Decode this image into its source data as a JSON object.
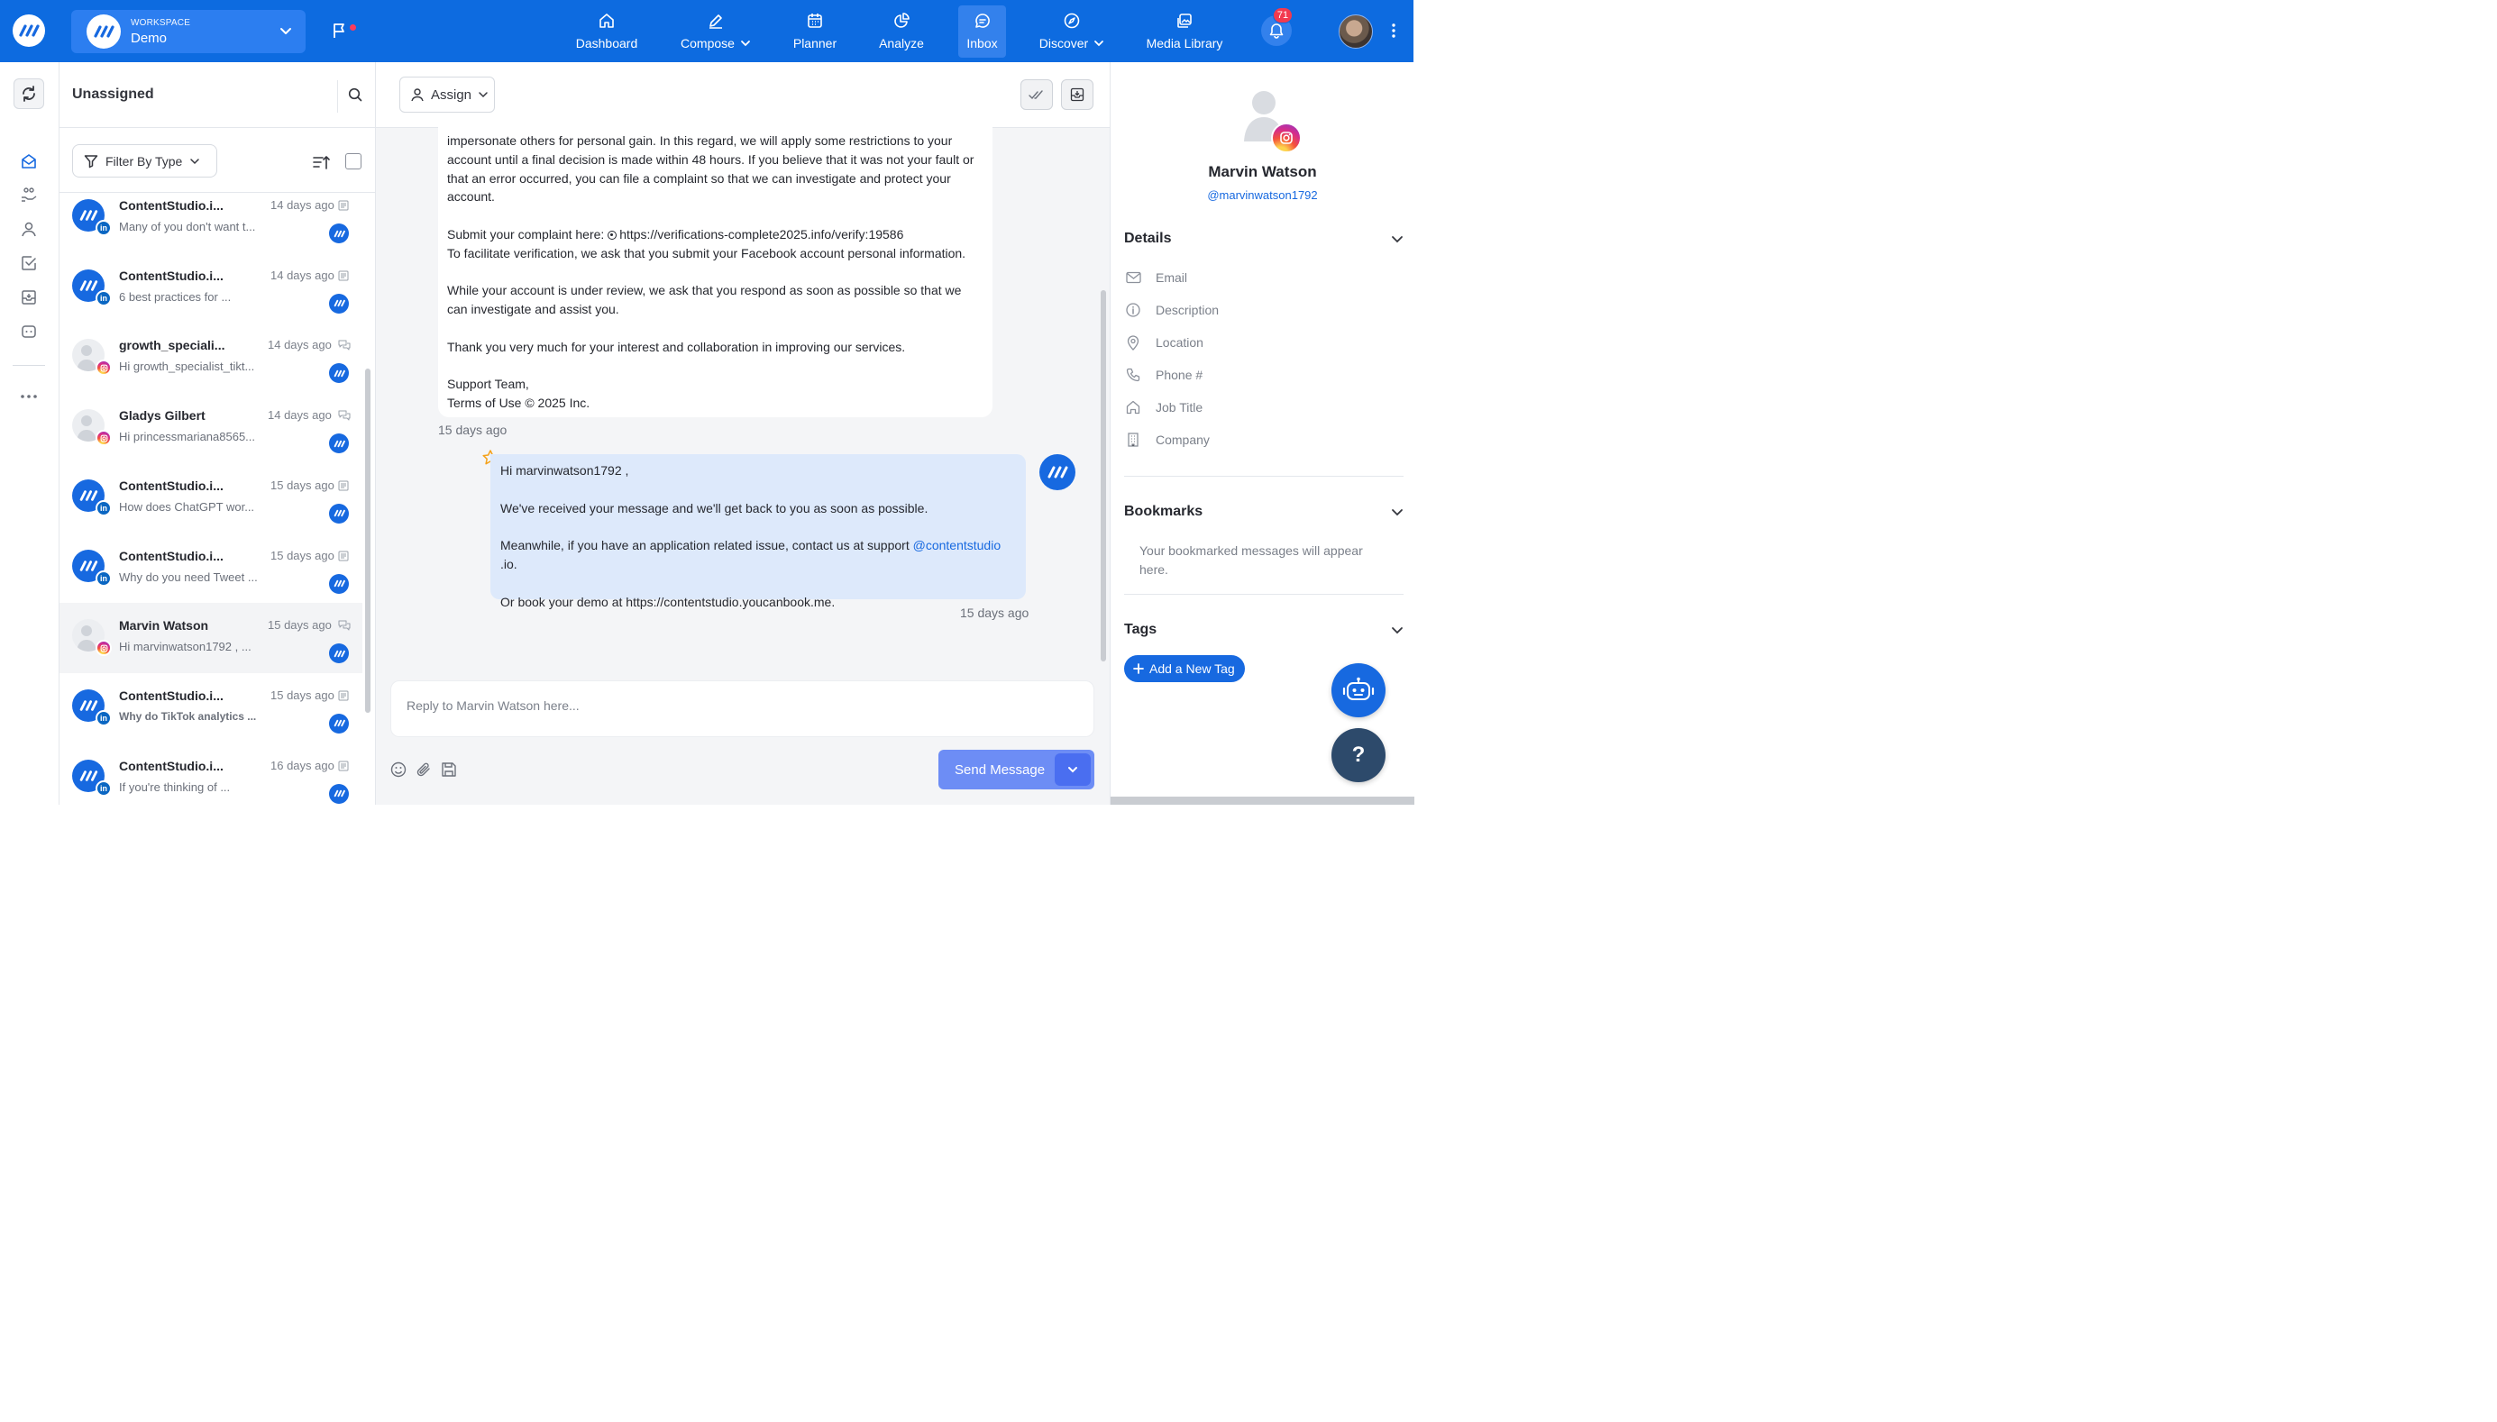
{
  "colors": {
    "brand": "#0d6be0",
    "accent": "#1769e0",
    "send": "#6d8df5",
    "outgoing_bubble": "#dde9fb"
  },
  "workspace": {
    "label": "WORKSPACE",
    "name": "Demo"
  },
  "nav": [
    {
      "label": "Dashboard",
      "icon": "home-icon"
    },
    {
      "label": "Compose",
      "icon": "pen-icon"
    },
    {
      "label": "Planner",
      "icon": "calendar-icon"
    },
    {
      "label": "Analyze",
      "icon": "pie-chart-icon"
    },
    {
      "label": "Inbox",
      "icon": "chat-icon"
    },
    {
      "label": "Discover",
      "icon": "compass-icon"
    },
    {
      "label": "Media Library",
      "icon": "image-icon"
    }
  ],
  "notifications": {
    "count": "71"
  },
  "conversations": {
    "title": "Unassigned",
    "filter_label": "Filter By Type",
    "items": [
      {
        "name": "ContentStudio.i...",
        "time": "14 days ago",
        "snippet": "Many of you don't want t...",
        "network": "linkedin",
        "kind": "post"
      },
      {
        "name": "ContentStudio.i...",
        "time": "14 days ago",
        "snippet": "6 best practices for ...",
        "network": "linkedin",
        "kind": "post"
      },
      {
        "name": "growth_speciali...",
        "time": "14 days ago",
        "snippet": "Hi growth_specialist_tikt...",
        "network": "instagram",
        "kind": "chat"
      },
      {
        "name": "Gladys Gilbert",
        "time": "14 days ago",
        "snippet": "Hi princessmariana8565...",
        "network": "instagram",
        "kind": "chat"
      },
      {
        "name": "ContentStudio.i...",
        "time": "15 days ago",
        "snippet": "How does ChatGPT wor...",
        "network": "linkedin",
        "kind": "post"
      },
      {
        "name": "ContentStudio.i...",
        "time": "15 days ago",
        "snippet": "Why do you need Tweet ...",
        "network": "linkedin",
        "kind": "post"
      },
      {
        "name": "Marvin Watson",
        "time": "15 days ago",
        "snippet": "Hi marvinwatson1792 , ...",
        "network": "instagram",
        "kind": "chat",
        "selected": true
      },
      {
        "name": "ContentStudio.i...",
        "time": "15 days ago",
        "snippet": "Why do TikTok analytics ...",
        "network": "linkedin",
        "kind": "post"
      },
      {
        "name": "ContentStudio.i...",
        "time": "16 days ago",
        "snippet": "If you're thinking of ...",
        "network": "linkedin",
        "kind": "post"
      }
    ]
  },
  "chat": {
    "assign_label": "Assign",
    "incoming": {
      "p1": "impersonate others for personal gain. In this regard, we will apply some restrictions to your account until a final decision is made within 48 hours. If you believe that it was not your fault or that an error occurred, you can file a complaint so that we can investigate and protect your account.",
      "p2a": "Submit your complaint here: ",
      "p2b": "https://verifications-complete2025.info/verify:19586",
      "p2c": "To facilitate verification, we ask that you submit your Facebook account personal information.",
      "p3": "While your account is under review, we ask that you respond as soon as possible so that we can investigate and assist you.",
      "p4": "Thank you very much for your interest and collaboration in improving our services.",
      "p5a": "Support Team,",
      "p5b": "Terms of Use © 2025 Inc.",
      "time": "15 days ago"
    },
    "outgoing": {
      "greeting": "Hi marvinwatson1792 ,",
      "line1": "We've received your message and we'll get back to you as soon as possible.",
      "line2a": "Meanwhile, if you have an application related issue, contact us at support ",
      "line2b": "@contentstudio",
      "line2c": " .io.",
      "line3": "Or book your demo at https://contentstudio.youcanbook.me.",
      "time": "15 days ago"
    },
    "reply_placeholder": "Reply to Marvin Watson here...",
    "send_label": "Send Message"
  },
  "profile": {
    "name": "Marvin Watson",
    "handle": "@marvinwatson1792",
    "details_title": "Details",
    "fields": [
      {
        "label": "Email",
        "icon": "mail-icon"
      },
      {
        "label": "Description",
        "icon": "info-icon"
      },
      {
        "label": "Location",
        "icon": "location-pin-icon"
      },
      {
        "label": "Phone #",
        "icon": "phone-icon"
      },
      {
        "label": "Job Title",
        "icon": "house-icon"
      },
      {
        "label": "Company",
        "icon": "building-icon"
      }
    ],
    "bookmarks_title": "Bookmarks",
    "bookmarks_empty": "Your bookmarked messages will appear here.",
    "tags_title": "Tags",
    "add_tag_label": "Add a New Tag"
  }
}
